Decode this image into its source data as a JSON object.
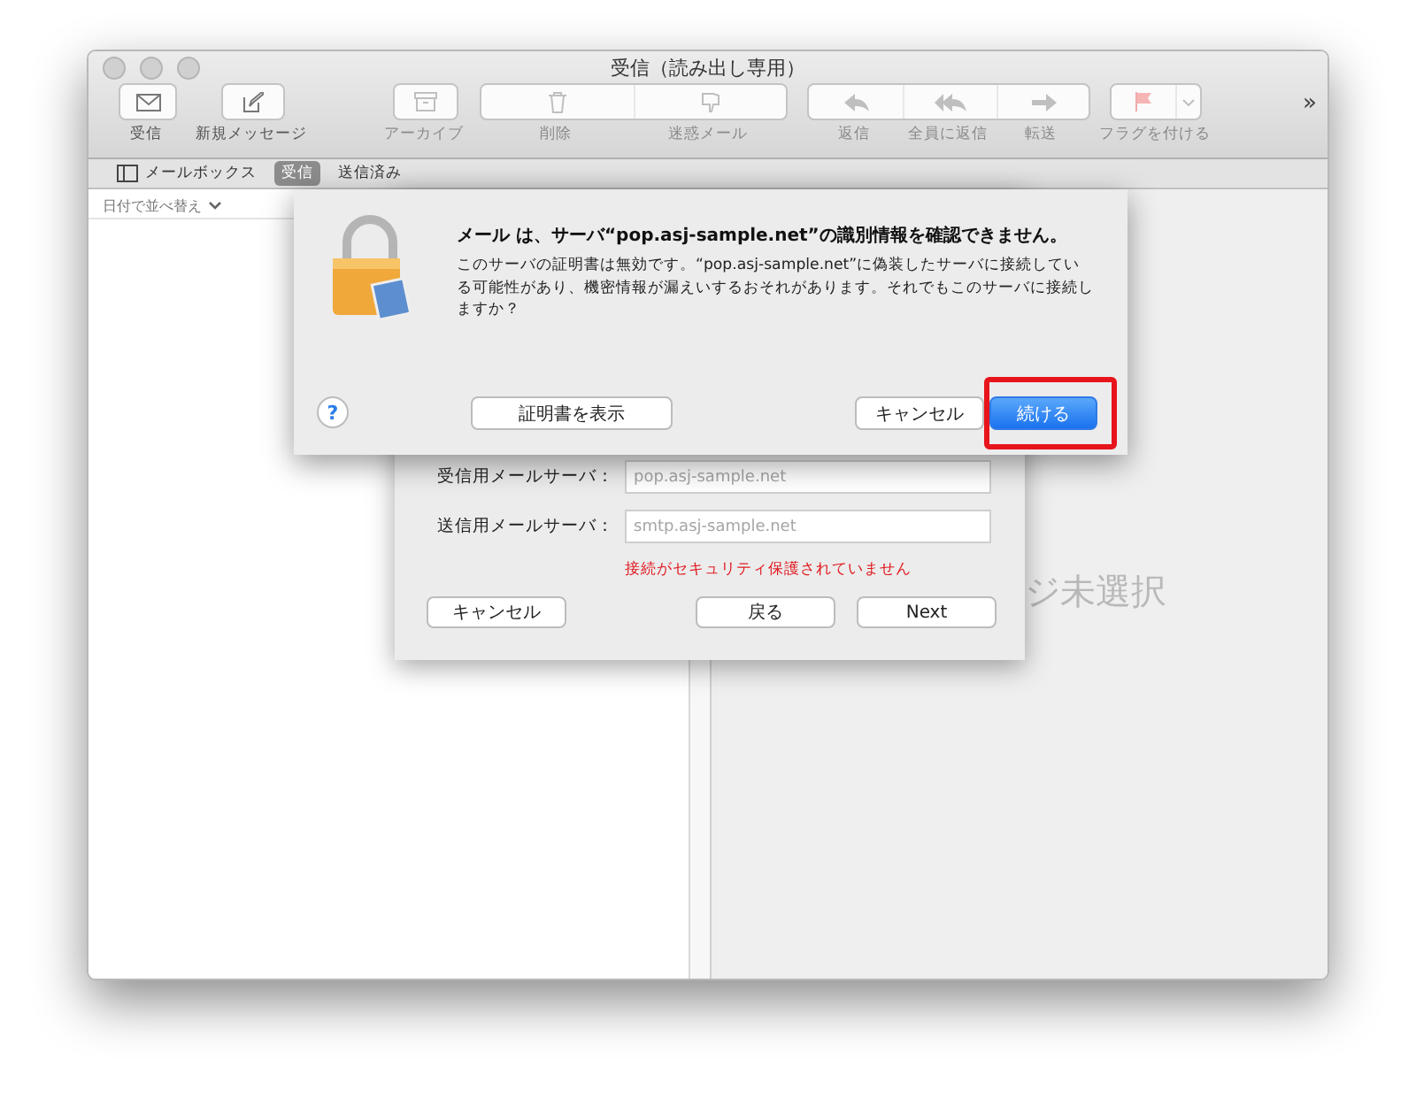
{
  "window": {
    "title": "受信（読み出し専用）"
  },
  "toolbar": {
    "groups": [
      {
        "items": [
          {
            "label": "受信",
            "disabled": false
          }
        ]
      },
      {
        "items": [
          {
            "label": "新規メッセージ",
            "disabled": false
          }
        ]
      },
      {
        "items": [
          {
            "label": "アーカイブ",
            "disabled": true
          }
        ]
      },
      {
        "items": [
          {
            "label": "削除",
            "disabled": true
          },
          {
            "label": "迷惑メール",
            "disabled": true
          }
        ]
      },
      {
        "items": [
          {
            "label": "返信",
            "disabled": true
          },
          {
            "label": "全員に返信",
            "disabled": true
          },
          {
            "label": "転送",
            "disabled": true
          }
        ]
      },
      {
        "items": [
          {
            "label": "フラグを付ける",
            "disabled": true
          }
        ]
      }
    ],
    "overflow": "»"
  },
  "favorites": [
    {
      "label": "メールボックス",
      "kind": "toggle",
      "selected": false
    },
    {
      "label": "受信",
      "kind": "mailbox",
      "selected": true
    },
    {
      "label": "送信済み",
      "kind": "mailbox",
      "selected": false
    }
  ],
  "message_list": {
    "sort": "日付で並べ替え"
  },
  "preview": {
    "empty_text": "ジ未選択"
  },
  "account_sheet": {
    "fields": [
      {
        "label": "受信用メールサーバ：",
        "value": "pop.asj-sample.net"
      },
      {
        "label": "送信用メールサーバ：",
        "value": "smtp.asj-sample.net"
      }
    ],
    "warning": "接続がセキュリティ保護されていません",
    "buttons": [
      {
        "label": "キャンセル"
      },
      {
        "label": "戻る"
      },
      {
        "label": "Next"
      }
    ]
  },
  "alert": {
    "title": "メール は、サーバ“pop.asj-sample.net”の識別情報を確認できません。",
    "message": "このサーバの証明書は無効です。“pop.asj-sample.net”に偽装したサーバに接続している可能性があり、機密情報が漏えいするおそれがあります。それでもこのサーバに接続しますか？",
    "help": "?",
    "buttons": [
      {
        "label": "証明書を表示",
        "kind": "secondary",
        "highlighted": false
      },
      {
        "label": "キャンセル",
        "kind": "secondary",
        "highlighted": false
      },
      {
        "label": "続ける",
        "kind": "default",
        "highlighted": true
      }
    ]
  }
}
